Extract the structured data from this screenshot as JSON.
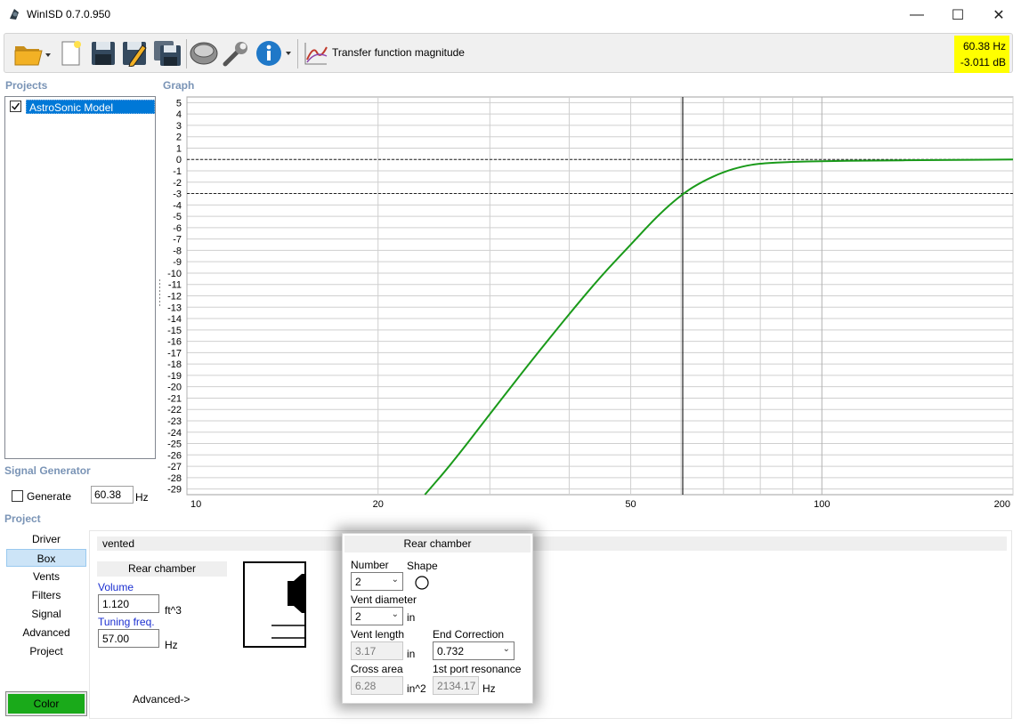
{
  "window": {
    "title": "WinISD 0.7.0.950",
    "minimize": "—",
    "maximize": "☐",
    "close": "✕"
  },
  "toolbar": {
    "graph_label": "Transfer function magnitude",
    "readout_freq": "60.38 Hz",
    "readout_db": "-3.011 dB",
    "icons": [
      "open-folder-icon",
      "new-document-icon",
      "save-icon",
      "save-as-icon",
      "save-all-icon",
      "driver-speaker-icon",
      "wrench-icon",
      "info-icon",
      "graph-icon"
    ]
  },
  "projects": {
    "label": "Projects",
    "items": [
      {
        "name": "AstroSonic Model",
        "checked": true
      }
    ]
  },
  "graph": {
    "label": "Graph"
  },
  "chart_data": {
    "type": "line",
    "xscale": "log",
    "xlim": [
      10,
      200
    ],
    "ylim": [
      -29.5,
      5.5
    ],
    "x_ticks": [
      "10",
      "20",
      "50",
      "100",
      "200"
    ],
    "y_ticks": [
      "5",
      "4",
      "3",
      "2",
      "1",
      "0",
      "-1",
      "-2",
      "-3",
      "-4",
      "-5",
      "-6",
      "-7",
      "-8",
      "-9",
      "-10",
      "-11",
      "-12",
      "-13",
      "-14",
      "-15",
      "-16",
      "-17",
      "-18",
      "-19",
      "-20",
      "-21",
      "-22",
      "-23",
      "-24",
      "-25",
      "-26",
      "-27",
      "-28",
      "-29"
    ],
    "series": [
      {
        "color": "#1a9a1a",
        "points": [
          [
            23.7,
            -29.5
          ],
          [
            26,
            -26.9
          ],
          [
            30,
            -22.4
          ],
          [
            35,
            -17.6
          ],
          [
            40,
            -13.6
          ],
          [
            45,
            -10.2
          ],
          [
            50,
            -7.5
          ],
          [
            55,
            -5.0
          ],
          [
            60.38,
            -3.0
          ],
          [
            65,
            -1.9
          ],
          [
            70,
            -1.1
          ],
          [
            75,
            -0.6
          ],
          [
            80,
            -0.35
          ],
          [
            90,
            -0.2
          ],
          [
            100,
            -0.15
          ],
          [
            120,
            -0.1
          ],
          [
            150,
            -0.05
          ],
          [
            200,
            0
          ]
        ]
      }
    ],
    "reference_lines_y": [
      0,
      -3
    ],
    "cursor_x": 60.38,
    "grid": true
  },
  "signal_generator": {
    "label": "Signal Generator",
    "generate_label": "Generate",
    "generate_checked": false,
    "frequency": "60.38",
    "unit": "Hz"
  },
  "project_nav": {
    "label": "Project",
    "items": [
      "Driver",
      "Box",
      "Vents",
      "Filters",
      "Signal",
      "Advanced",
      "Project"
    ],
    "selected": "Box",
    "color_button": "Color",
    "color_value": "#1aaa1a"
  },
  "box": {
    "type": "vented",
    "rear_chamber_header": "Rear chamber",
    "volume_label": "Volume",
    "volume": "1.120",
    "volume_unit": "ft^3",
    "tuning_label": "Tuning freq.",
    "tuning": "57.00",
    "tuning_unit": "Hz",
    "advanced_link": "Advanced->"
  },
  "vent_popup": {
    "header": "Rear chamber",
    "number_label": "Number",
    "number": "2",
    "shape_label": "Shape",
    "diameter_label": "Vent diameter",
    "diameter": "2",
    "diameter_unit": "in",
    "length_label": "Vent length",
    "length": "3.17",
    "length_unit": "in",
    "end_correction_label": "End Correction",
    "end_correction": "0.732",
    "cross_area_label": "Cross area",
    "cross_area": "6.28",
    "cross_area_unit": "in^2",
    "port_resonance_label": "1st port resonance",
    "port_resonance": "2134.17",
    "port_resonance_unit": "Hz"
  }
}
